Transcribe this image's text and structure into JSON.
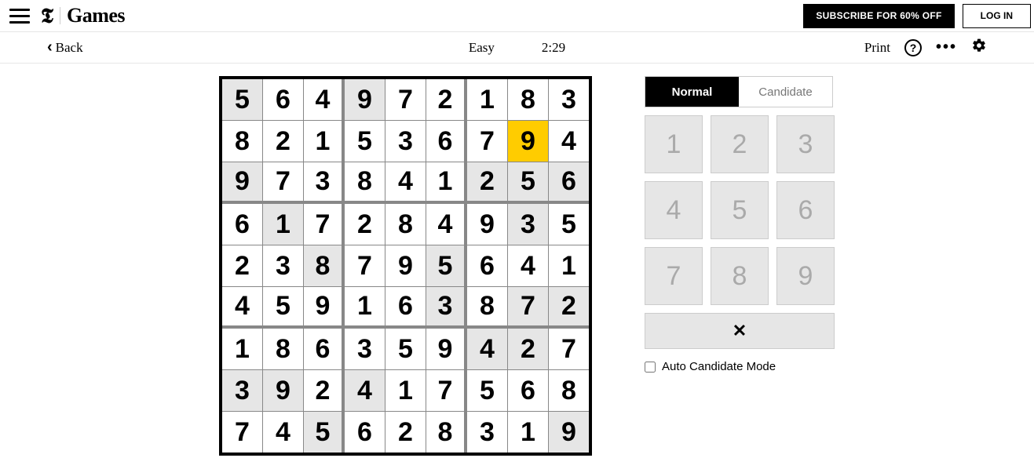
{
  "header": {
    "brand_t": "𝕿",
    "brand_games": "Games",
    "subscribe": "SUBSCRIBE FOR 60% OFF",
    "login": "LOG IN"
  },
  "toolbar": {
    "back": "Back",
    "difficulty": "Easy",
    "timer": "2:29",
    "print": "Print",
    "help_glyph": "?",
    "more_glyph": "•••"
  },
  "sudoku": {
    "grid": [
      [
        5,
        6,
        4,
        9,
        7,
        2,
        1,
        8,
        3
      ],
      [
        8,
        2,
        1,
        5,
        3,
        6,
        7,
        9,
        4
      ],
      [
        9,
        7,
        3,
        8,
        4,
        1,
        2,
        5,
        6
      ],
      [
        6,
        1,
        7,
        2,
        8,
        4,
        9,
        3,
        5
      ],
      [
        2,
        3,
        8,
        7,
        9,
        5,
        6,
        4,
        1
      ],
      [
        4,
        5,
        9,
        1,
        6,
        3,
        8,
        7,
        2
      ],
      [
        1,
        8,
        6,
        3,
        5,
        9,
        4,
        2,
        7
      ],
      [
        3,
        9,
        2,
        4,
        1,
        7,
        5,
        6,
        8
      ],
      [
        7,
        4,
        5,
        6,
        2,
        8,
        3,
        1,
        9
      ]
    ],
    "given": [
      [
        1,
        0,
        0,
        1,
        0,
        0,
        0,
        0,
        0
      ],
      [
        0,
        0,
        0,
        0,
        0,
        0,
        0,
        0,
        0
      ],
      [
        1,
        0,
        0,
        0,
        0,
        0,
        1,
        1,
        1
      ],
      [
        0,
        1,
        0,
        0,
        0,
        0,
        0,
        1,
        0
      ],
      [
        0,
        0,
        1,
        0,
        0,
        1,
        0,
        0,
        0
      ],
      [
        0,
        0,
        0,
        0,
        0,
        1,
        0,
        1,
        1
      ],
      [
        0,
        0,
        0,
        0,
        0,
        0,
        1,
        1,
        0
      ],
      [
        1,
        1,
        0,
        1,
        0,
        0,
        0,
        0,
        0
      ],
      [
        0,
        0,
        1,
        0,
        0,
        0,
        0,
        0,
        1
      ]
    ],
    "selected": [
      1,
      7
    ]
  },
  "panel": {
    "mode_normal": "Normal",
    "mode_candidate": "Candidate",
    "keys": [
      "1",
      "2",
      "3",
      "4",
      "5",
      "6",
      "7",
      "8",
      "9"
    ],
    "clear_glyph": "✕",
    "auto_label": "Auto Candidate Mode"
  }
}
